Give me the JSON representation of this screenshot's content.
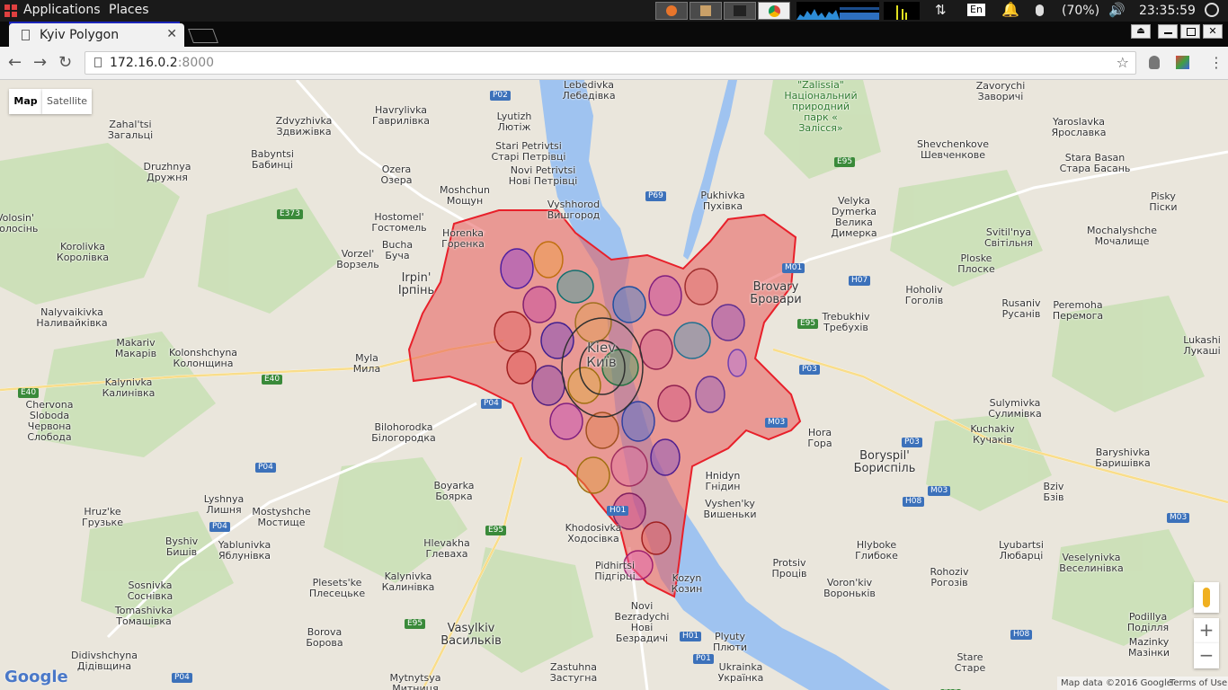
{
  "panel": {
    "applications": "Applications",
    "places": "Places",
    "keyboard_layout": "En",
    "battery": "(70%)",
    "clock": "23:35:59"
  },
  "browser": {
    "tab_title": "Kyiv Polygon",
    "url_host": "172.16.0.2",
    "url_port": ":8000"
  },
  "map": {
    "type_map": "Map",
    "type_satellite": "Satellite",
    "zoom_in": "+",
    "zoom_out": "−",
    "attribution": "Map data ©2016 Google",
    "terms": "Terms of Use",
    "google_logo": "Google",
    "labels": [
      "Lebedivka\nЛебедівка",
      "Zahal'tsi\nЗагальці",
      "Zdvyzhivka\nЗдвижівка",
      "Havrylivka\nГаврилівка",
      "Lyutizh\nЛютіж",
      "Stari Petrivtsi\nСтарі Петрівці",
      "Novi Petrivtsi\nНові Петрівці",
      "Vyshhorod\nВишгород",
      "Babyntsi\nБабинці",
      "Druzhnya\nДружня",
      "Ozera\nОзера",
      "Moshchun\nМощун",
      "Volosin'\nВолосінь",
      "Hostomel'\nГостомель",
      "Horenka\nГоренка",
      "Korolivka\nКоролівка",
      "Vorzel'\nВорзель",
      "Bucha\nБуча",
      "Irpin'\nІрпінь",
      "Nalyvaikivka\nНаливайківка",
      "Makariv\nМакарів",
      "Kolonshchyna\nКолонщина",
      "Myla\nМила",
      "Kalynivka\nКалинівка",
      "Chervona\nSloboda\nЧервона\nСлобода",
      "Bilohorodka\nБілогородка",
      "Boyarka\nБоярка",
      "Lyshnya\nЛишня",
      "Hruz'ke\nГрузьке",
      "Mostyshche\nМостище",
      "Byshiv\nБишів",
      "Yablunivka\nЯблунівка",
      "Hlevakha\nГлеваха",
      "Sosnivka\nСоснівка",
      "Plesets'ke\nПлесецьке",
      "Kalynivka\nКалинівка",
      "Tomashivka\nТомашівка",
      "Borova\nБорова",
      "Vasylkiv\nВасильків",
      "Didivshchyna\nДідівщина",
      "Mytnytsya\nМитниця",
      "Khodosivka\nХодосівка",
      "Pidhirtsi\nПідгірці",
      "Novi\nBezradychi\nНові\nБезрадичі",
      "Zastuhna\nЗастугна",
      "Kozyn\nКозин",
      "Plyuty\nПлюти",
      "Ukrainka\nУкраїнка",
      "Hnidyn\nГнідин",
      "Vyshen'ky\nВишеньки",
      "Protsiv\nПроців",
      "Voron'kiv\nВороньків",
      "Hlyboke\nГлибоке",
      "Rohoziv\nРогозів",
      "Stare\nСтаре",
      "Pukhivka\nПухівка",
      "Brovary\nБровари",
      "Trebukhiv\nТребухів",
      "Hora\nГора",
      "Boryspil'\nБориспіль",
      "Kuchakiv\nКучаків",
      "Hnidyn",
      "Velyka\nDymerka\nВелика\nДимерка",
      "Svitil'nya\nСвітільня",
      "Ploske\nПлоске",
      "Hoholiv\nГоголів",
      "Rusaniv\nРусанів",
      "Peremoha\nПеремога",
      "Zavorychi\nЗаворичі",
      "Shevchenkove\nШевченкове",
      "Yaroslavka\nЯрославка",
      "Stara Basan\nСтара Басань",
      "Pisky\nПіски",
      "Mochalyshche\nМочалище",
      "Lukashi\nЛукаші",
      "Sulymivka\nСулимівка",
      "Baryshivka\nБаришівка",
      "Bziv\nБзів",
      "Lyubartsi\nЛюбарці",
      "Veselynivka\nВеселинівка",
      "Podillya\nПоділля",
      "Mazinky\nМазінки",
      "\"Zalissia\"\nНаціональний\nприродний\nпарк «\nЗалісся»",
      "Kiev\nКиїв"
    ],
    "road_shields": [
      "P02",
      "P69",
      "E373",
      "M01",
      "H07",
      "E95",
      "P03",
      "E95",
      "M03",
      "P03",
      "H08",
      "M03",
      "P04",
      "P04",
      "P04",
      "E40",
      "E40",
      "E95",
      "H01",
      "H01",
      "P01",
      "E95",
      "P04",
      "H08",
      "M03",
      "E95"
    ]
  },
  "colors": {
    "panel_bg": "#1a1a1a",
    "water": "#9fc3f0",
    "park": "#c8dfb4",
    "road_shield": "#3c71ba"
  }
}
